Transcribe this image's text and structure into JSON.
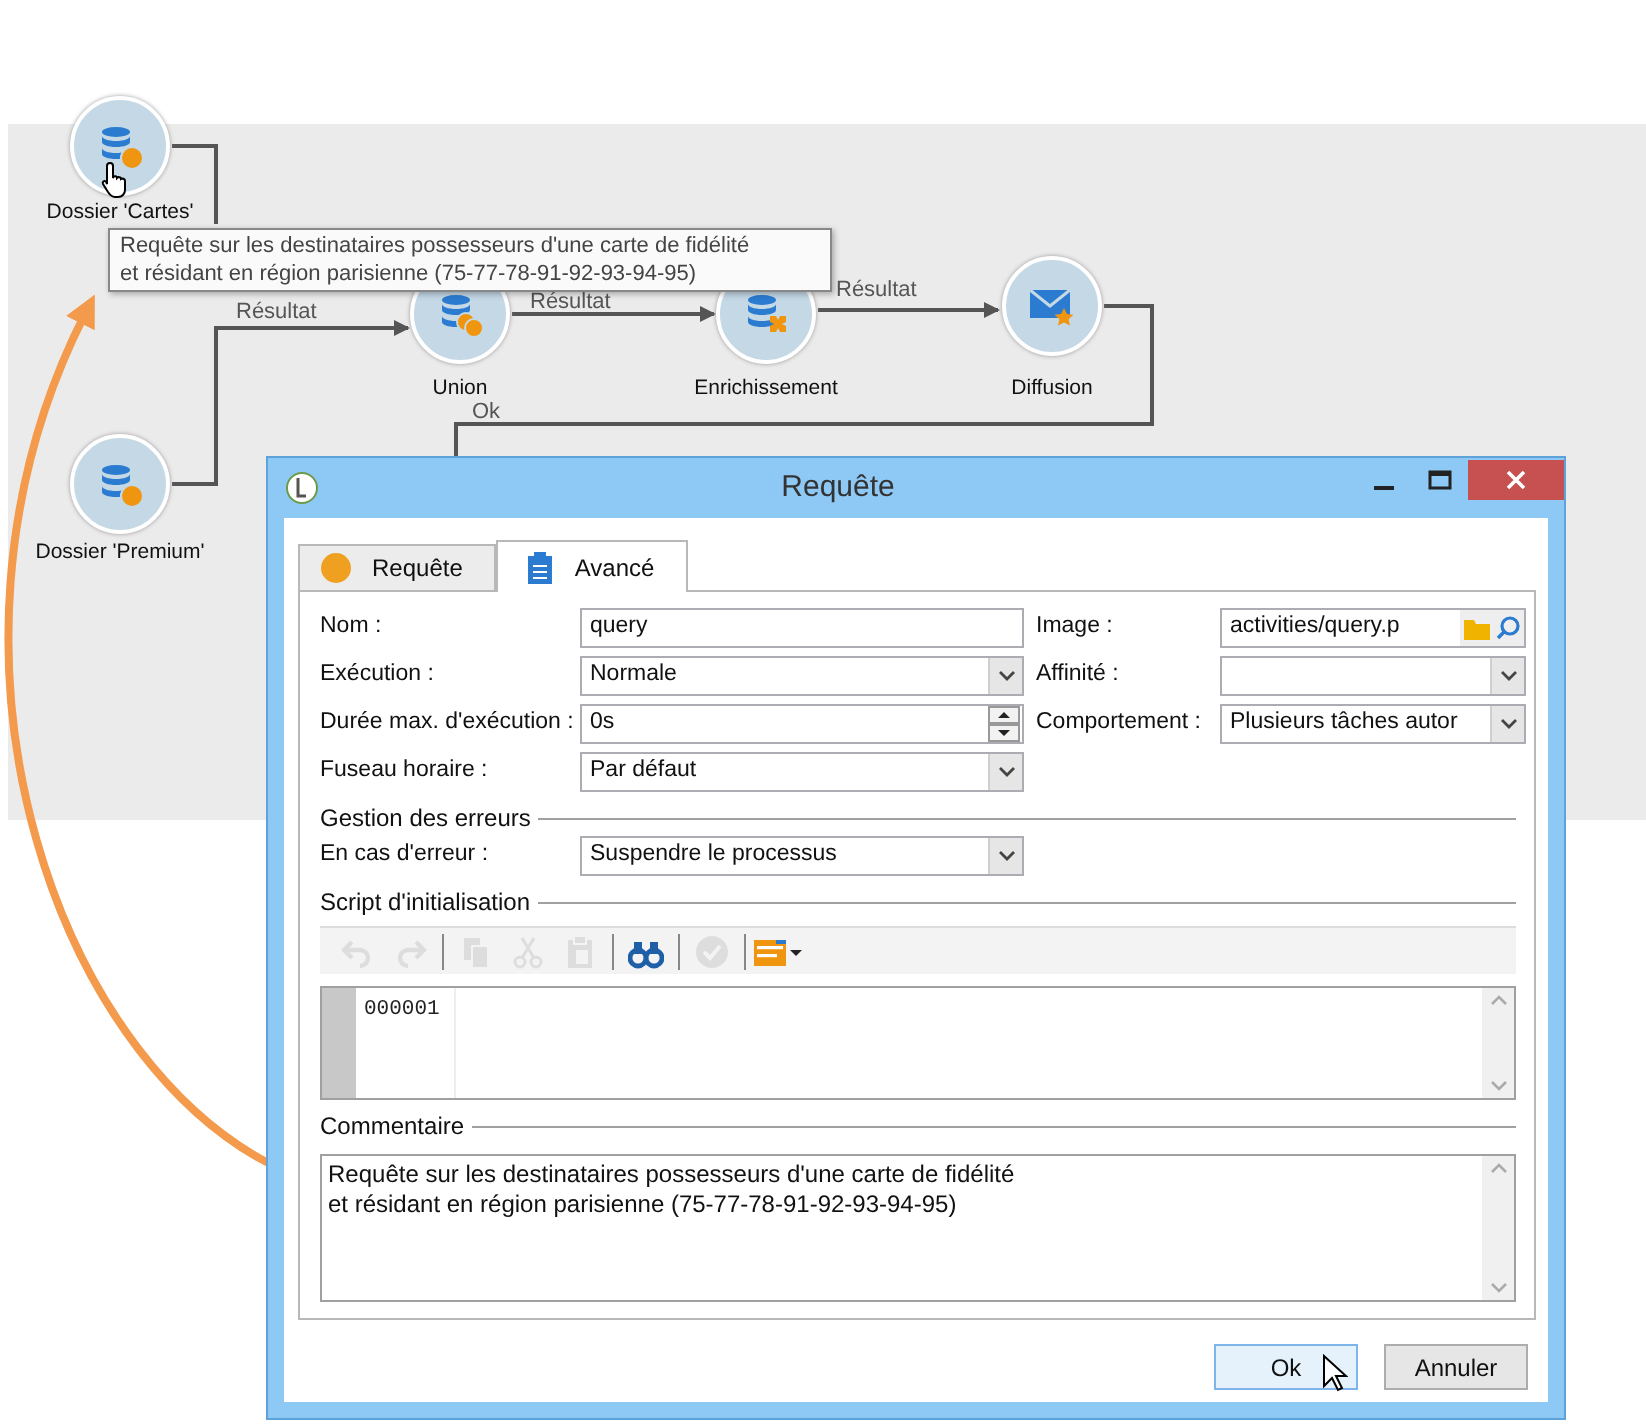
{
  "workflow": {
    "nodes": [
      {
        "label": "Dossier 'Cartes'",
        "kind": "query"
      },
      {
        "label": "Dossier 'Premium'",
        "kind": "query"
      },
      {
        "label": "Union",
        "kind": "union"
      },
      {
        "label": "Enrichissement",
        "kind": "enrichment"
      },
      {
        "label": "Diffusion",
        "kind": "delivery"
      }
    ],
    "transitions": [
      {
        "label": "Résultat"
      },
      {
        "label": "Résultat"
      },
      {
        "label": "Résultat"
      },
      {
        "label": "Ok"
      }
    ],
    "tooltip": "Requête sur les destinataires possesseurs d'une carte de fidélité\net résidant en région parisienne (75-77-78-91-92-93-94-95)"
  },
  "dialog": {
    "title": "Requête",
    "tabs": [
      {
        "label": "Requête",
        "selected": false,
        "kind": "query"
      },
      {
        "label": "Avancé",
        "selected": true,
        "kind": "advanced"
      }
    ],
    "left_fields": [
      {
        "label": "Nom :",
        "value": "query",
        "kind": "text"
      },
      {
        "label": "Exécution :",
        "value": "Normale",
        "kind": "select"
      },
      {
        "label": "Durée max. d'exécution :",
        "value": "0s",
        "kind": "spinner"
      },
      {
        "label": "Fuseau horaire :",
        "value": "Par défaut",
        "kind": "select"
      }
    ],
    "right_fields": [
      {
        "label": "Image :",
        "value": "activities/query.p",
        "kind": "picker"
      },
      {
        "label": "Affinité :",
        "kind": "select"
      },
      {
        "label": "Comportement :",
        "value": "Plusieurs tâches autor",
        "kind": "select"
      }
    ],
    "error_section": {
      "title": "Gestion des erreurs",
      "fields": [
        {
          "label": "En cas d'erreur :",
          "value": "Suspendre le processus",
          "kind": "select"
        }
      ]
    },
    "script_section": {
      "title": "Script d'initialisation",
      "toolbar": [
        [
          {
            "kind": "undo",
            "disabled": true
          },
          {
            "kind": "redo",
            "disabled": true
          }
        ],
        [
          {
            "kind": "copy",
            "disabled": true
          },
          {
            "kind": "cut",
            "disabled": true
          },
          {
            "kind": "paste",
            "disabled": true
          }
        ],
        [
          {
            "kind": "find",
            "disabled": false
          }
        ],
        [
          {
            "kind": "check",
            "disabled": true
          }
        ],
        [
          {
            "kind": "insert",
            "disabled": false
          }
        ]
      ],
      "line_numbers": [
        "000001"
      ]
    },
    "comment_section": {
      "title": "Commentaire",
      "text": "Requête sur les destinataires possesseurs d'une carte de fidélité\net résidant en région parisienne (75-77-78-91-92-93-94-95)"
    },
    "buttons": [
      {
        "label": "Ok",
        "default": true
      },
      {
        "label": "Annuler",
        "default": false
      }
    ]
  }
}
